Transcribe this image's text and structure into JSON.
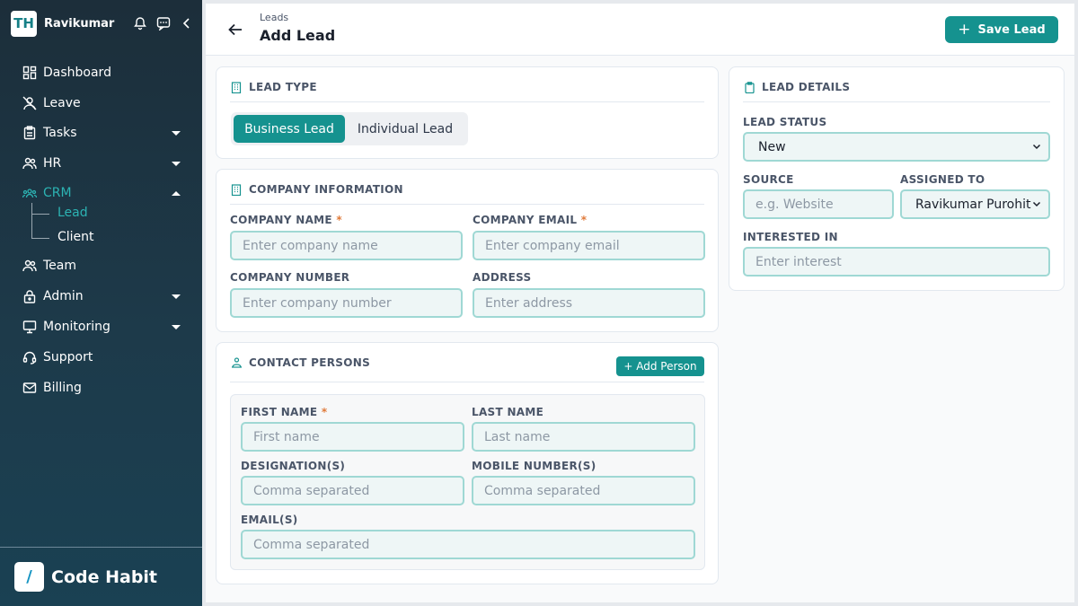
{
  "app": {
    "user_name": "Ravikumar",
    "logo_text": "TH",
    "brand": "Code Habit",
    "brand_logo_text": "/"
  },
  "sidebar": {
    "items": [
      {
        "label": "Dashboard"
      },
      {
        "label": "Leave"
      },
      {
        "label": "Tasks"
      },
      {
        "label": "HR"
      },
      {
        "label": "CRM"
      },
      {
        "label": "Team"
      },
      {
        "label": "Admin"
      },
      {
        "label": "Monitoring"
      },
      {
        "label": "Support"
      },
      {
        "label": "Billing"
      }
    ],
    "crm_sub": [
      {
        "label": "Lead"
      },
      {
        "label": "Client"
      }
    ]
  },
  "header": {
    "breadcrumb": "Leads",
    "title": "Add Lead",
    "save_label": "Save Lead"
  },
  "lead_type": {
    "title": "LEAD TYPE",
    "options": [
      "Business Lead",
      "Individual Lead"
    ],
    "selected": "Business Lead"
  },
  "company": {
    "title": "COMPANY INFORMATION",
    "name_label": "COMPANY NAME",
    "name_placeholder": "Enter company name",
    "email_label": "COMPANY EMAIL",
    "email_placeholder": "Enter company email",
    "number_label": "COMPANY NUMBER",
    "number_placeholder": "Enter company number",
    "address_label": "ADDRESS",
    "address_placeholder": "Enter address",
    "required_mark": "*"
  },
  "contacts": {
    "title": "CONTACT PERSONS",
    "add_label": "+ Add Person",
    "first_label": "FIRST NAME",
    "first_placeholder": "First name",
    "last_label": "LAST NAME",
    "last_placeholder": "Last name",
    "designation_label": "DESIGNATION(S)",
    "designation_placeholder": "Comma separated",
    "mobile_label": "MOBILE NUMBER(S)",
    "mobile_placeholder": "Comma separated",
    "email_label": "EMAIL(S)",
    "email_placeholder": "Comma separated",
    "required_mark": "*"
  },
  "details": {
    "title": "LEAD DETAILS",
    "status_label": "LEAD STATUS",
    "status_value": "New",
    "source_label": "SOURCE",
    "source_placeholder": "e.g. Website",
    "assigned_label": "ASSIGNED TO",
    "assigned_value": "Ravikumar Purohit",
    "interest_label": "INTERESTED IN",
    "interest_placeholder": "Enter interest"
  },
  "colors": {
    "accent": "#15928f",
    "sidebar": "#1d3a4a",
    "active_nav": "#2cb3b3",
    "required": "#e07a3a"
  }
}
